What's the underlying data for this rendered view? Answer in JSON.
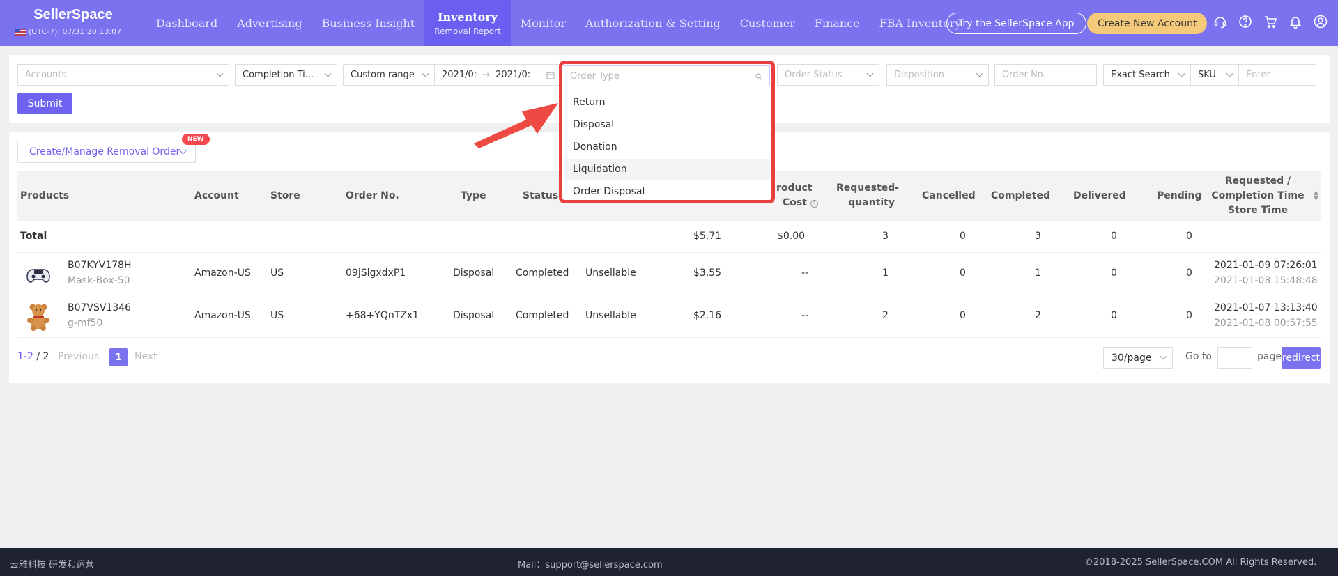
{
  "app": {
    "logo": "SellerSpace",
    "timezone": "(UTC-7): 07/31 20:13:07"
  },
  "nav": [
    {
      "label": "Dashboard"
    },
    {
      "label": "Advertising"
    },
    {
      "label": "Business Insight"
    },
    {
      "label": "Inventory",
      "sub": "Removal Report",
      "active": true
    },
    {
      "label": "Monitor"
    },
    {
      "label": "Authorization & Setting"
    },
    {
      "label": "Customer"
    },
    {
      "label": "Finance"
    },
    {
      "label": "FBA Inventory"
    }
  ],
  "header_buttons": {
    "try_app": "Try the SellerSpace App",
    "create_account": "Create New Account"
  },
  "header_icons": [
    "headset-icon",
    "help-icon",
    "cart-icon",
    "bell-icon",
    "user-icon"
  ],
  "filters": {
    "accounts_placeholder": "Accounts",
    "completion_time": "Completion Ti...",
    "range": "Custom range",
    "date_start": "2021/0:",
    "date_sep": "→",
    "date_end": "2021/0:",
    "order_type_placeholder": "Order Type",
    "order_status_placeholder": "Order Status",
    "disposition_placeholder": "Disposition",
    "order_no_placeholder": "Order No.",
    "search_mode": "Exact Search",
    "search_field": "SKU",
    "search_placeholder": "Enter",
    "submit": "Submit"
  },
  "order_type_options": [
    "Return",
    "Disposal",
    "Donation",
    "Liquidation",
    "Order Disposal"
  ],
  "hovered_option": "Liquidation",
  "manage": {
    "label": "Create/Manage Removal Order",
    "badge": "NEW"
  },
  "columns": {
    "products": "Products",
    "account": "Account",
    "store": "Store",
    "order_no": "Order No.",
    "type": "Type",
    "status": "Status",
    "product_cost_1": "roduct",
    "product_cost_2": "Cost",
    "requested_1": "Requested-",
    "requested_2": "quantity",
    "cancelled": "Cancelled",
    "completed": "Completed",
    "delivered": "Delivered",
    "pending": "Pending",
    "time_1": "Requested /",
    "time_2": "Completion Time",
    "time_3": "Store Time"
  },
  "total": {
    "label": "Total",
    "fee": "$5.71",
    "cost": "$0.00",
    "requested": "3",
    "cancelled": "0",
    "completed": "3",
    "delivered": "0",
    "pending": "0"
  },
  "rows": [
    {
      "asin": "B07KYV178H",
      "sku": "Mask-Box-50",
      "account": "Amazon-US",
      "store": "US",
      "order_no": "09jSlgxdxP1",
      "type": "Disposal",
      "status": "Completed",
      "disposition": "Unsellable",
      "fee": "$3.55",
      "cost": "--",
      "requested": "1",
      "cancelled": "0",
      "completed": "1",
      "delivered": "0",
      "pending": "0",
      "time_req": "2021-01-09 07:26:01",
      "time_store": "2021-01-08 15:48:48"
    },
    {
      "asin": "B07VSV1346",
      "sku": "g-mf50",
      "account": "Amazon-US",
      "store": "US",
      "order_no": "+68+YQnTZx1",
      "type": "Disposal",
      "status": "Completed",
      "disposition": "Unsellable",
      "fee": "$2.16",
      "cost": "--",
      "requested": "2",
      "cancelled": "0",
      "completed": "2",
      "delivered": "0",
      "pending": "0",
      "time_req": "2021-01-07 13:13:40",
      "time_store": "2021-01-08 00:57:55"
    }
  ],
  "pagination": {
    "range": "1-2",
    "sep": "/",
    "total": "2",
    "previous": "Previous",
    "page": "1",
    "next": "Next",
    "per_page": "30/page",
    "goto": "Go to",
    "page_label": "page",
    "redirect": "redirect"
  },
  "footer": {
    "left": "云雅科技 研发和运营",
    "mail": "Mail：support@sellerspace.com",
    "copyright": "©2018-2025 SellerSpace.COM All Rights Reserved."
  },
  "colors": {
    "brand": "#7b72f0",
    "accent": "#f4c97a",
    "highlight": "#e8403f"
  }
}
